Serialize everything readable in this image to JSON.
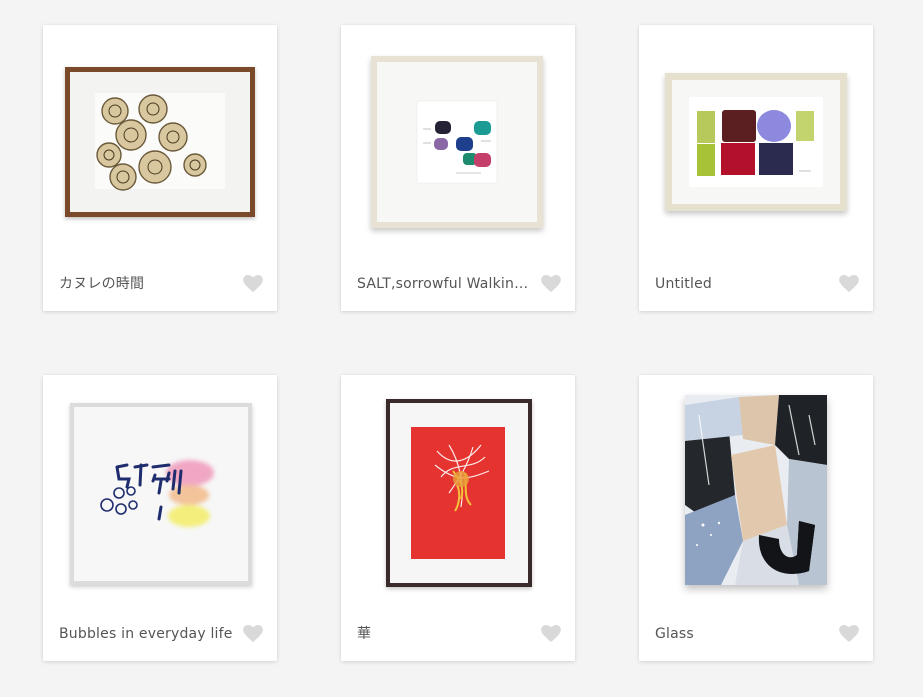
{
  "artworks": [
    {
      "title": "カヌレの時間",
      "icon": "heart-icon"
    },
    {
      "title": "SALT,sorrowful Walking…",
      "icon": "heart-icon"
    },
    {
      "title": "Untitled",
      "icon": "heart-icon"
    },
    {
      "title": "Bubbles in everyday life",
      "icon": "heart-icon"
    },
    {
      "title": "華",
      "icon": "heart-icon"
    },
    {
      "title": "Glass",
      "icon": "heart-icon"
    }
  ],
  "colors": {
    "background": "#f4f4f4",
    "card": "#ffffff",
    "title_text": "#555555",
    "heart": "#d9d9d9"
  }
}
